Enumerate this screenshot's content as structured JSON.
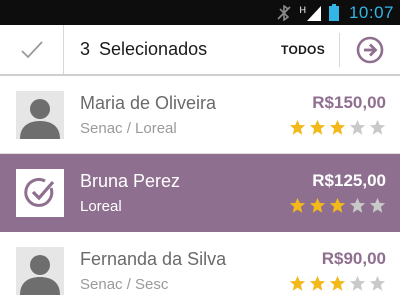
{
  "status_bar": {
    "network": "H",
    "time": "10:07"
  },
  "action_bar": {
    "selected_count": "3",
    "selected_label": "Selecionados",
    "all_label": "TODOS"
  },
  "colors": {
    "accent": "#8f6f8f",
    "star_on": "#f3b81a",
    "star_off": "#c9c9c9",
    "status_blue": "#33b5e5"
  },
  "items": [
    {
      "name": "Maria de Oliveira",
      "sub": "Senac / Loreal",
      "price": "R$150,00",
      "rating": 3,
      "max_rating": 5,
      "selected": false
    },
    {
      "name": "Bruna Perez",
      "sub": "Loreal",
      "price": "R$125,00",
      "rating": 3,
      "max_rating": 5,
      "selected": true
    },
    {
      "name": "Fernanda da Silva",
      "sub": "Senac / Sesc",
      "price": "R$90,00",
      "rating": 3,
      "max_rating": 5,
      "selected": false
    }
  ]
}
